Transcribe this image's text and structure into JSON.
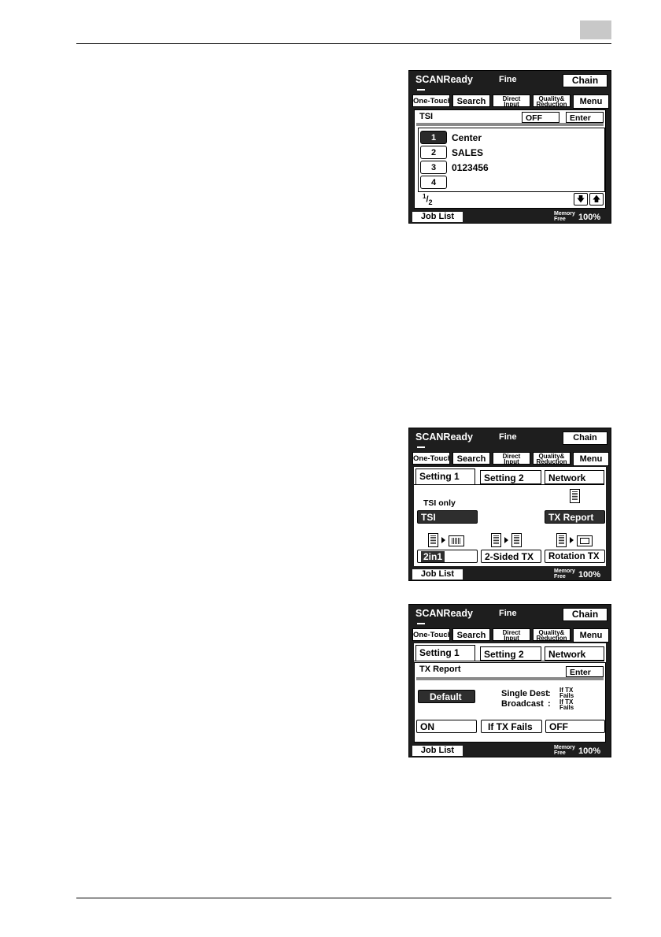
{
  "page": {
    "section_tab_color": "#c8c8c8"
  },
  "screens": [
    {
      "status": {
        "title": "SCANReady",
        "mode": "Fine",
        "chain": "Chain"
      },
      "tabs": {
        "one_touch": "One-Touch",
        "search": "Search",
        "direct_input_1": "Direct",
        "direct_input_2": "Input",
        "quality_1": "Quality&",
        "quality_2": "Reduction",
        "menu": "Menu"
      },
      "panel": {
        "title": "TSI",
        "off_button": "OFF",
        "enter_button": "Enter",
        "list": [
          {
            "num": "1",
            "label": "Center",
            "selected": true
          },
          {
            "num": "2",
            "label": "SALES",
            "selected": false
          },
          {
            "num": "3",
            "label": "0123456",
            "selected": false
          },
          {
            "num": "4",
            "label": "",
            "selected": false
          }
        ],
        "page_num": "1",
        "page_total": "2"
      },
      "footer": {
        "job_list": "Job List",
        "memory_1": "Memory",
        "memory_2": "Free",
        "memory_pct": "100%"
      }
    },
    {
      "status": {
        "title": "SCANReady",
        "mode": "Fine",
        "chain": "Chain"
      },
      "tabs": {
        "one_touch": "One-Touch",
        "search": "Search",
        "direct_input_1": "Direct",
        "direct_input_2": "Input",
        "quality_1": "Quality&",
        "quality_2": "Reduction",
        "menu": "Menu"
      },
      "panel": {
        "setting_tabs": [
          "Setting 1",
          "Setting 2",
          "Network"
        ],
        "tsi_caption": "TSI only",
        "tsi_button": "TSI",
        "tx_report_button": "TX Report",
        "two_in_one_button": "2in1",
        "two_sided_button": "2-Sided TX",
        "rotation_button": "Rotation TX"
      },
      "footer": {
        "job_list": "Job List",
        "memory_1": "Memory",
        "memory_2": "Free",
        "memory_pct": "100%"
      }
    },
    {
      "status": {
        "title": "SCANReady",
        "mode": "Fine",
        "chain": "Chain"
      },
      "tabs": {
        "one_touch": "One-Touch",
        "search": "Search",
        "direct_input_1": "Direct",
        "direct_input_2": "Input",
        "quality_1": "Quality&",
        "quality_2": "Reduction",
        "menu": "Menu"
      },
      "panel": {
        "setting_tabs": [
          "Setting 1",
          "Setting 2",
          "Network"
        ],
        "title": "TX Report",
        "enter_button": "Enter",
        "default_button": "Default",
        "single_dest": "Single Dest",
        "broadcast": "Broadcast",
        "colon": ":",
        "val_1": "If TX",
        "val_2": "Fails",
        "on_button": "ON",
        "if_fails_button": "If TX Fails",
        "off_button": "OFF"
      },
      "footer": {
        "job_list": "Job List",
        "memory_1": "Memory",
        "memory_2": "Free",
        "memory_pct": "100%"
      }
    }
  ]
}
